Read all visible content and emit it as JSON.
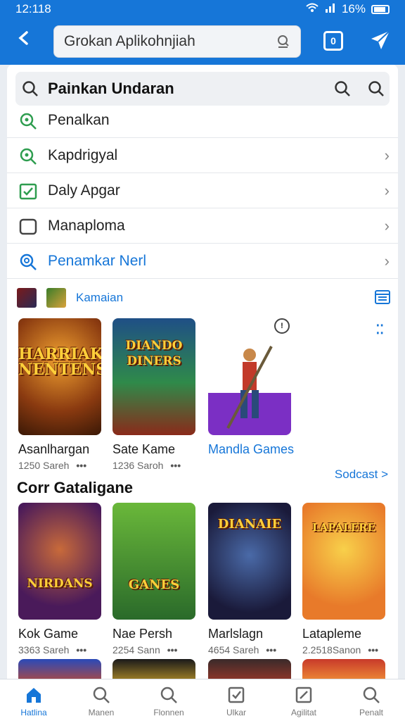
{
  "status": {
    "time": "12:118",
    "battery": "16%"
  },
  "search": {
    "value": "Grokan Aplikohnjiah"
  },
  "suggest_header": {
    "query": "Painkan Undaran"
  },
  "suggestions": [
    {
      "label": "Penalkan",
      "has_chevron": false
    },
    {
      "label": "Kapdrigyal",
      "has_chevron": true
    },
    {
      "label": "Daly Apgar",
      "has_chevron": true
    },
    {
      "label": "Manaploma",
      "has_chevron": true
    },
    {
      "label": "Penamkar Nerl",
      "has_chevron": true
    }
  ],
  "mini_row": {
    "label": "Kamaian"
  },
  "featured": [
    {
      "title_art": "HARRIAK NENTENS",
      "name": "Asanlhargan",
      "size": "1250 Sareh"
    },
    {
      "title_art": "DIANDO DINERS",
      "name": "Sate Kame",
      "size": "1236 Saroh"
    },
    {
      "title_art": "",
      "name": "Mandla Games",
      "size": ""
    }
  ],
  "featured_badge": "!",
  "section": {
    "title": "Corr Gataligane",
    "see_all": "Sodcast >"
  },
  "games": [
    {
      "title_art": "NIRDANS",
      "name": "Kok Game",
      "size": "3363 Sareh"
    },
    {
      "title_art": "GANES",
      "name": "Nae Persh",
      "size": "2254 Sann"
    },
    {
      "title_art": "DIANAIE",
      "name": "Marlslagn",
      "size": "4654 Sareh"
    },
    {
      "title_art": "LAPALERE",
      "name": "Latapleme",
      "size": "2.2518Sanon"
    }
  ],
  "bottom_nav": [
    {
      "label": "Hatlina",
      "icon": "home-icon",
      "active": true
    },
    {
      "label": "Manen",
      "icon": "search-icon",
      "active": false
    },
    {
      "label": "Flonnen",
      "icon": "search-icon",
      "active": false
    },
    {
      "label": "Ulkar",
      "icon": "checkbox-icon",
      "active": false
    },
    {
      "label": "Agilitat",
      "icon": "edit-icon",
      "active": false
    },
    {
      "label": "Penalt",
      "icon": "search-icon",
      "active": false
    }
  ],
  "colors": {
    "brand": "#1676d8",
    "suggest_icon": "#2e9d4f"
  }
}
